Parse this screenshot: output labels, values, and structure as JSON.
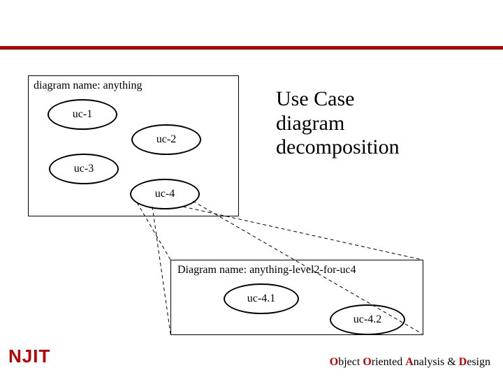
{
  "title_line1": "Use Case",
  "title_line2": "diagram",
  "title_line3": "decomposition",
  "top_box": {
    "label": "diagram name: anything",
    "uc1": "uc-1",
    "uc2": "uc-2",
    "uc3": "uc-3",
    "uc4": "uc-4"
  },
  "bottom_box": {
    "label": "Diagram name: anything-level2-for-uc4",
    "uc41": "uc-4.1",
    "uc42": "uc-4.2"
  },
  "logo": "NJIT",
  "footer": {
    "o1": "O",
    "t1": "bject ",
    "o2": "O",
    "t2": "riented ",
    "a": "A",
    "t3": "nalysis & ",
    "d": "D",
    "t4": "esign"
  }
}
